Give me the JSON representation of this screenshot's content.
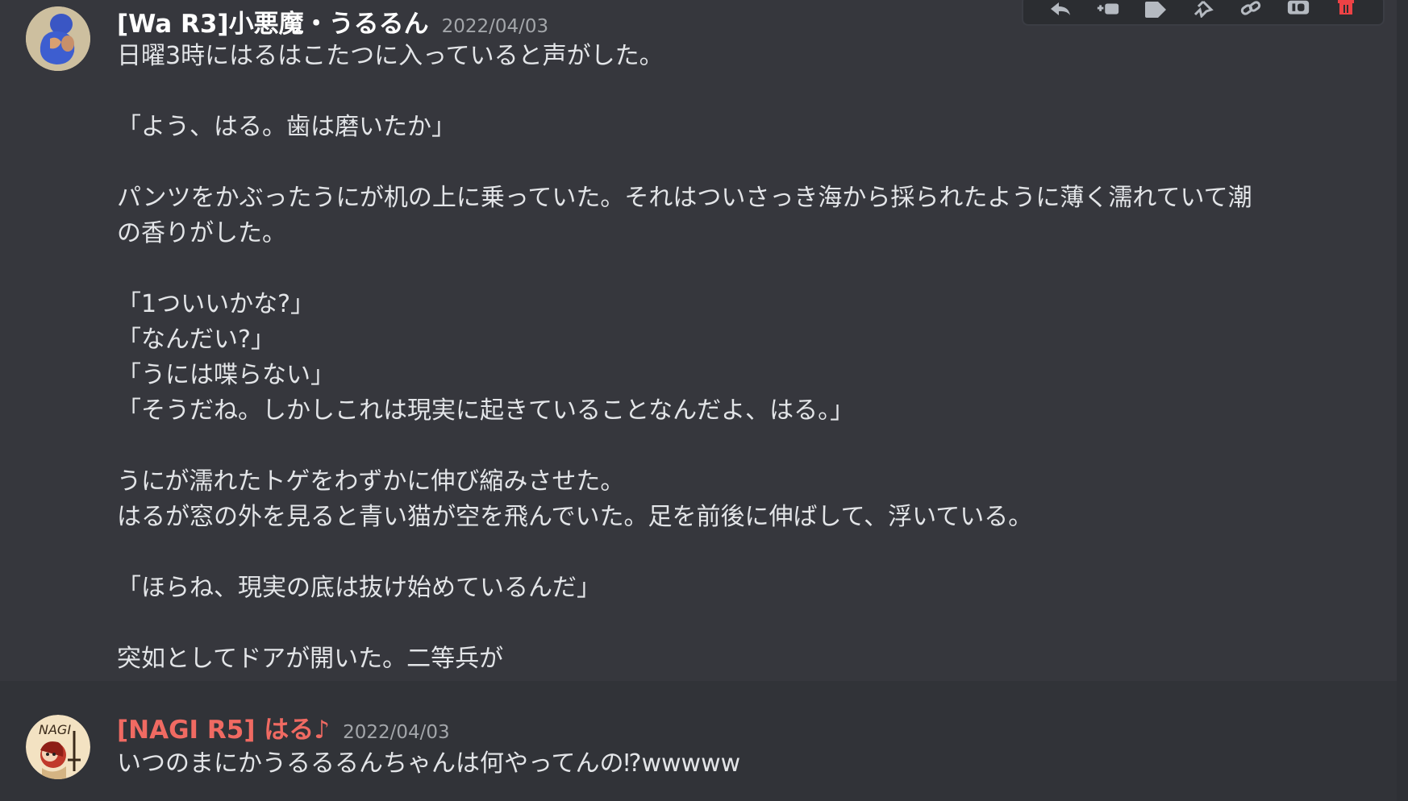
{
  "messages": [
    {
      "username": "[Wa R3]小悪魔・うるるん",
      "timestamp": "2022/04/03",
      "avatar_icon": "avatar-blue-figure-icon",
      "lines": [
        "日曜3時にはるはこたつに入っていると声がした。",
        "",
        "「よう、はる。歯は磨いたか」",
        "",
        "パンツをかぶったうにが机の上に乗っていた。それはついさっき海から採られたように薄く濡れていて潮",
        "の香りがした。",
        "",
        "「1ついいかな?」",
        "「なんだい?」",
        "「うには喋らない」",
        "「そうだね。しかしこれは現実に起きていることなんだよ、はる。」",
        "",
        "うにが濡れたトゲをわずかに伸び縮みさせた。",
        "はるが窓の外を見ると青い猫が空を飛んでいた。足を前後に伸ばして、浮いている。",
        "",
        "「ほらね、現実の底は抜け始めているんだ」",
        "",
        "突如としてドアが開いた。二等兵が"
      ]
    },
    {
      "username": "[NAGI R5] はる♪",
      "timestamp": "2022/04/03",
      "avatar_icon": "avatar-nagi-icon",
      "avatar_text": "NAGI",
      "lines": [
        "いつのまにかうるるるんちゃんは何やってんの⁉︎wwwww"
      ]
    }
  ],
  "toolbar": {
    "icons": [
      "reply-icon",
      "create-thread-icon",
      "tag-icon",
      "pin-icon",
      "link-icon",
      "id-icon",
      "delete-icon"
    ]
  },
  "colors": {
    "background": "#313338",
    "hover_background": "#36373d",
    "username_primary": "#ffffff",
    "username_secondary": "#f06a62",
    "timestamp": "#a3a6aa",
    "text": "#e3e5e8",
    "danger": "#ed4245"
  }
}
